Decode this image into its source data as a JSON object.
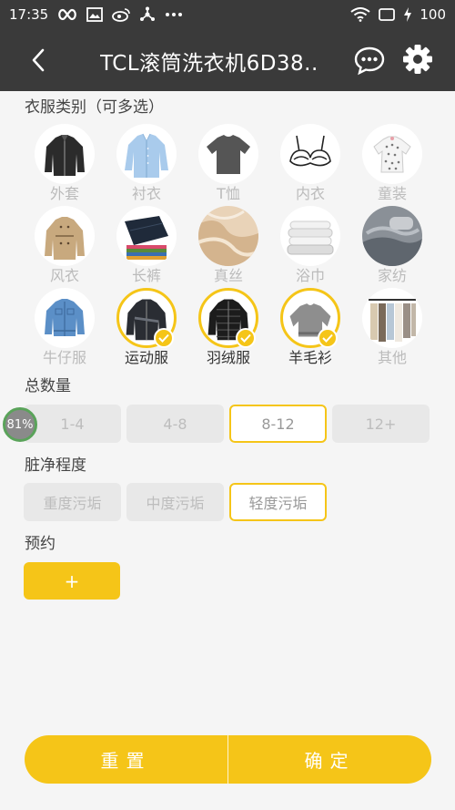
{
  "status_bar": {
    "time": "17:35",
    "battery": "100"
  },
  "header": {
    "title": "TCL滚筒洗衣机6D38.."
  },
  "categories": {
    "title": "衣服类别（可多选）",
    "items": [
      {
        "label": "外套",
        "icon": "jacket",
        "selected": false
      },
      {
        "label": "衬衣",
        "icon": "shirt",
        "selected": false
      },
      {
        "label": "T恤",
        "icon": "tshirt",
        "selected": false
      },
      {
        "label": "内衣",
        "icon": "bra",
        "selected": false
      },
      {
        "label": "童装",
        "icon": "kids-clothes",
        "selected": false
      },
      {
        "label": "风衣",
        "icon": "trench-coat",
        "selected": false
      },
      {
        "label": "长裤",
        "icon": "trousers",
        "selected": false
      },
      {
        "label": "真丝",
        "icon": "silk",
        "selected": false
      },
      {
        "label": "浴巾",
        "icon": "towel",
        "selected": false
      },
      {
        "label": "家纺",
        "icon": "bedding",
        "selected": false
      },
      {
        "label": "牛仔服",
        "icon": "denim-jacket",
        "selected": false
      },
      {
        "label": "运动服",
        "icon": "sportswear",
        "selected": true
      },
      {
        "label": "羽绒服",
        "icon": "down-jacket",
        "selected": true
      },
      {
        "label": "羊毛衫",
        "icon": "sweater",
        "selected": true
      },
      {
        "label": "其他",
        "icon": "other-clothes",
        "selected": false
      }
    ]
  },
  "quantity": {
    "title": "总数量",
    "options": [
      "1-4",
      "4-8",
      "8-12",
      "12+"
    ],
    "selected": "8-12",
    "badge": "81%"
  },
  "dirtiness": {
    "title": "脏净程度",
    "options": [
      "重度污垢",
      "中度污垢",
      "轻度污垢"
    ],
    "selected": "轻度污垢"
  },
  "reservation": {
    "title": "预约",
    "add_label": "+"
  },
  "footer": {
    "reset_label": "重置",
    "confirm_label": "确定"
  },
  "colors": {
    "accent": "#f5c518",
    "header_bg": "#3a3a3a",
    "page_bg": "#f5f5f5"
  }
}
